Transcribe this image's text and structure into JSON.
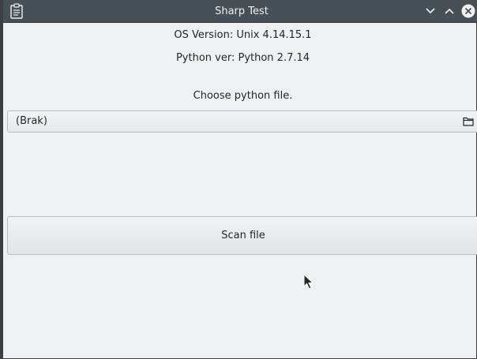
{
  "window": {
    "title": "Sharp Test"
  },
  "titlebar": {
    "app_icon": "clipboard-icon",
    "buttons": [
      "minimize-icon",
      "maximize-icon",
      "close-icon"
    ]
  },
  "main": {
    "os_version": "OS Version: Unix 4.14.15.1",
    "python_version": "Python ver: Python 2.7.14",
    "choose_label": "Choose python file.",
    "file_selector": {
      "value": "(Brak)",
      "icon": "folder-icon"
    },
    "scan_button_label": "Scan file"
  },
  "colors": {
    "titlebar": "#475057",
    "window_bg": "#eff0f1",
    "text": "#232629"
  }
}
